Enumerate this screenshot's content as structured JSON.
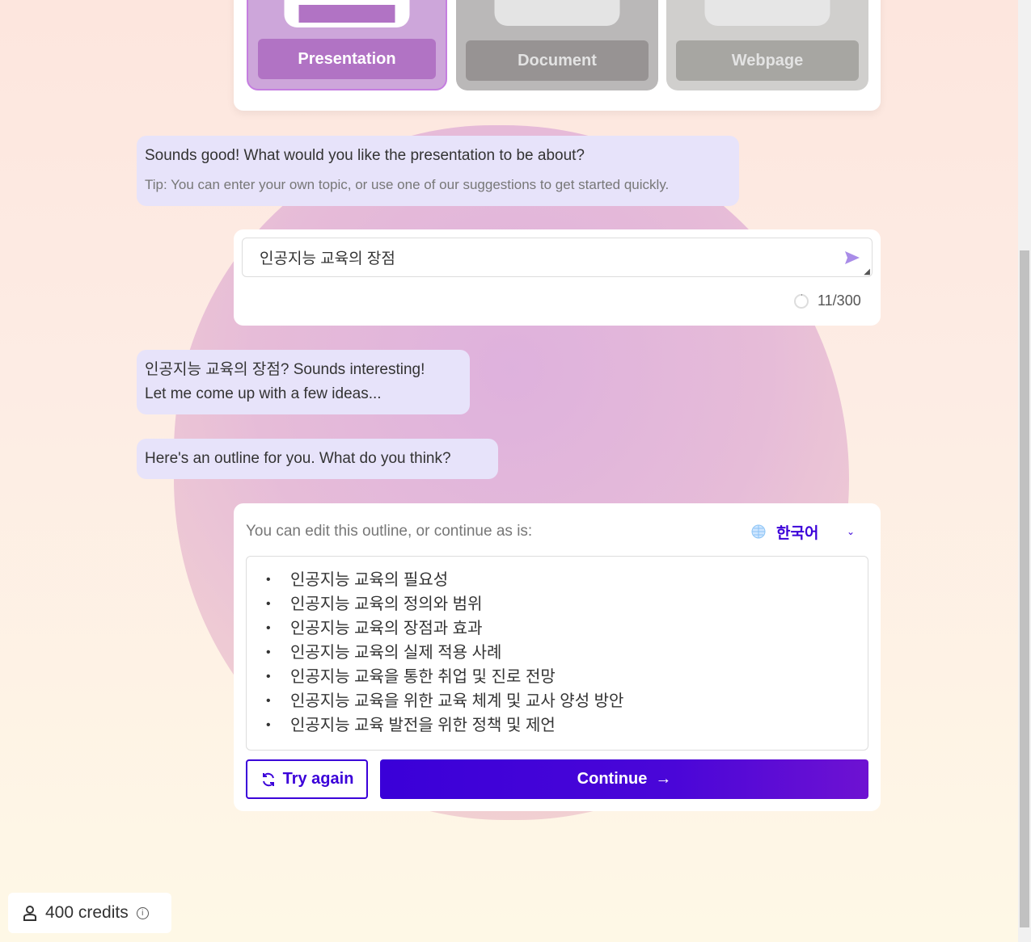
{
  "format_picker": {
    "options": [
      {
        "label": "Presentation",
        "selected": true
      },
      {
        "label": "Document",
        "selected": false
      },
      {
        "label": "Webpage",
        "selected": false
      }
    ]
  },
  "messages": {
    "ask_topic": "Sounds good! What would you like the presentation to be about?",
    "tip": "Tip: You can enter your own topic, or use one of our suggestions to get started quickly.",
    "reply_line1": "인공지능 교육의 장점? Sounds interesting!",
    "reply_line2": "Let me come up with a few ideas...",
    "outline_intro": "Here's an outline for you. What do you think?"
  },
  "topic_input": {
    "value": "인공지능 교육의 장점",
    "counter": "11/300",
    "send_icon": "send-icon"
  },
  "outline": {
    "header": "You can edit this outline, or continue as is:",
    "language": "한국어",
    "items": [
      "인공지능 교육의 필요성",
      "인공지능 교육의 정의와 범위",
      "인공지능 교육의 장점과 효과",
      "인공지능 교육의 실제 적용 사례",
      "인공지능 교육을 통한 취업 및 진로 전망",
      "인공지능 교육을 위한 교육 체계 및 교사 양성 방안",
      "인공지능 교육 발전을 위한 정책 및 제언"
    ],
    "try_again": "Try again",
    "continue": "Continue"
  },
  "credits": {
    "label": "400 credits"
  },
  "colors": {
    "accent": "#3b00d9",
    "bubble": "#e7e3fa",
    "presentation": "#b173c4"
  }
}
